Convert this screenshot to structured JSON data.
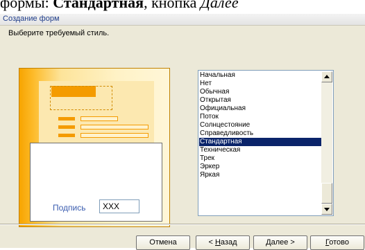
{
  "page_text": {
    "prefix": "формы: ",
    "bold": "Стандартная",
    "middle": ", кнопка ",
    "italic": "Далее"
  },
  "window": {
    "title": "Создание форм",
    "prompt": "Выберите требуемый стиль."
  },
  "preview": {
    "caption": "Подпись",
    "field_value": "XXX"
  },
  "style_list": {
    "items": [
      "Начальная",
      "Нет",
      "Обычная",
      "Открытая",
      "Официальная",
      "Поток",
      "Солнцестояние",
      "Справедливость",
      "Стандартная",
      "Техническая",
      "Трек",
      "Эркер",
      "Яркая"
    ],
    "selected": "Стандартная"
  },
  "buttons": {
    "cancel": "Отмена",
    "back_prefix": "< ",
    "back_mnemonic": "Н",
    "back_rest": "азад",
    "next_mnemonic": "Д",
    "next_rest": "алее >",
    "finish_mnemonic": "Г",
    "finish_rest": "отово"
  },
  "colors": {
    "selection": "#0a246a",
    "dialog_bg": "#ece9d8",
    "accent_orange": "#f49b00"
  }
}
